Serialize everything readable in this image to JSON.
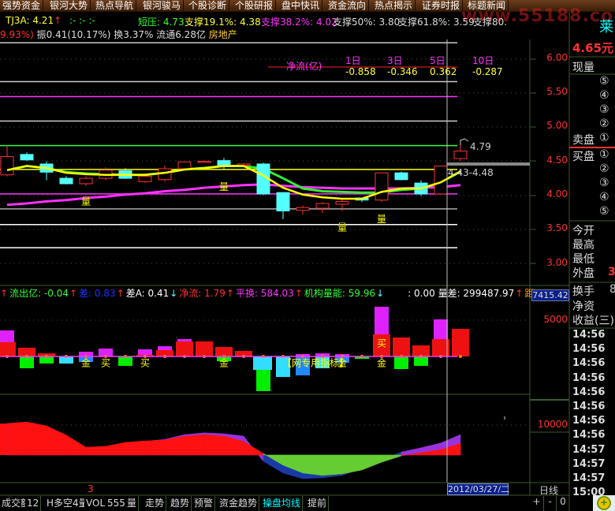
{
  "menu": [
    "强势资金",
    "银河大势",
    "热点导航",
    "银河骏马",
    "个股诊断",
    "个股研报",
    "盘中快讯",
    "资金流向",
    "热点揭示",
    "证券时报",
    "标题新闻"
  ],
  "watermark": "www.55188.com",
  "info_row": {
    "code": "TJ3A: 4.21",
    "code_arrow": "↑",
    "dashes": ":- :- :-",
    "short_pressure": "短压: 4.73",
    "support_19": "支撑19.1%: 4.38",
    "support_38": "支撑38.2%: 4.02",
    "support_50": "支撑50%: 3.80",
    "support_61": "支撑61.8%: 3.59",
    "support_80": "支撑80."
  },
  "stats_row": {
    "change": "9.93%)",
    "stats": "振0.41(10.17%) 换3.37% 流通6.28亿",
    "sector": "房地产"
  },
  "net_flow": {
    "label": "净流(亿)",
    "periods": [
      "1日",
      "3日",
      "5日",
      "10日"
    ],
    "values": [
      "-0.858",
      "-0.346",
      "0.362",
      "-0.287"
    ]
  },
  "price_labels": {
    "high_mark": "4.79",
    "range": "4.43-4.48"
  },
  "indicator_row": [
    {
      "text": "↑",
      "color": "#ff3232"
    },
    {
      "text": "流出亿: -0.04",
      "color": "#33ff33"
    },
    {
      "text": "↑",
      "color": "#ff3232"
    },
    {
      "text": "差: 0.83",
      "color": "#2030ff"
    },
    {
      "text": "↑",
      "color": "#ff3232"
    },
    {
      "text": "差A: 0.41",
      "color": "#ffffff"
    },
    {
      "text": "↓",
      "color": "#54ffff"
    },
    {
      "text": "净流: 1.79",
      "color": "#ff3232"
    },
    {
      "text": "↑",
      "color": "#ff3232"
    },
    {
      "text": "平换: 584.03",
      "color": "#ff33ff"
    },
    {
      "text": "↑",
      "color": "#ff3232"
    },
    {
      "text": "机构量能: 59.96",
      "color": "#33ff33"
    },
    {
      "text": "↓",
      "color": "#54ffff"
    },
    {
      "text": ": 0.00 量差: 299487.97",
      "color": "#ffffff"
    },
    {
      "text": "↑",
      "color": "#ff3232"
    },
    {
      "text": "距",
      "color": "#ff9900"
    }
  ],
  "axis_box_value": "7415.42",
  "right_panel": {
    "name_char": "莱",
    "price": "4.65元",
    "current_volume": "现量",
    "sell_label": "卖盘",
    "buy_label": "买盘",
    "sell_levels": [
      "⑤",
      "④",
      "③",
      "②",
      "①"
    ],
    "buy_levels": [
      "①",
      "②",
      "③",
      "④",
      "⑤"
    ],
    "open": "今开",
    "high": "最高",
    "low": "最低",
    "outer": "外盘",
    "outer_value": "3",
    "turnover": "换手",
    "turnover_value": "8",
    "net_assets": "净资",
    "eps": "收益(三)",
    "times": [
      "14:56",
      "14:56",
      "14:56",
      "14:56",
      "14:56",
      "14:56",
      "14:56",
      "14:56",
      "14:57",
      "14:57",
      "14:57",
      "15:00"
    ]
  },
  "status_row": {
    "marker": "3",
    "date": "2012/03/27/二",
    "period": "日线"
  },
  "tabs": [
    {
      "label": "成交额",
      "active": false
    },
    {
      "label": "12",
      "active": false
    },
    {
      "label": "H多空4量",
      "active": false
    },
    {
      "label": "VOL",
      "active": false
    },
    {
      "label": "555",
      "active": false
    },
    {
      "label": "量",
      "active": false
    },
    {
      "label": "走势",
      "active": false
    },
    {
      "label": "趋势",
      "active": false
    },
    {
      "label": "预警",
      "active": false
    },
    {
      "label": "资金趋势",
      "active": false
    },
    {
      "label": "操盘均线",
      "active": true
    },
    {
      "label": "提前",
      "active": false
    }
  ],
  "zoom_buttons": [
    "+",
    "-",
    "0"
  ],
  "colors": {
    "up": "#ff3232",
    "down": "#54ffff",
    "bg": "#000000",
    "grid": "#3a5a2a",
    "accent": "#00ffff"
  },
  "chart_data": [
    {
      "type": "candlestick",
      "y_ticks": [
        "6.00",
        "5.50",
        "5.00",
        "4.50",
        "4.00",
        "3.50",
        "3.00"
      ],
      "ylim": [
        3.0,
        6.0
      ],
      "candles": [
        [
          4.3,
          4.73,
          4.28,
          4.57
        ],
        [
          4.6,
          4.63,
          4.5,
          4.52
        ],
        [
          4.46,
          4.5,
          4.22,
          4.34
        ],
        [
          4.25,
          4.28,
          4.16,
          4.17
        ],
        [
          4.17,
          4.28,
          4.14,
          4.25
        ],
        [
          4.25,
          4.41,
          4.22,
          4.37
        ],
        [
          4.36,
          4.4,
          4.24,
          4.25
        ],
        [
          4.2,
          4.3,
          4.18,
          4.28
        ],
        [
          4.23,
          4.44,
          4.2,
          4.39
        ],
        [
          4.39,
          4.49,
          4.39,
          4.49
        ],
        [
          4.49,
          4.51,
          4.48,
          4.5
        ],
        [
          4.51,
          4.55,
          4.38,
          4.42
        ],
        [
          4.44,
          4.47,
          4.42,
          4.46
        ],
        [
          4.46,
          4.48,
          4.0,
          4.02
        ],
        [
          4.04,
          4.05,
          3.65,
          3.77
        ],
        [
          3.78,
          3.85,
          3.72,
          3.82
        ],
        [
          3.81,
          3.9,
          3.74,
          3.88
        ],
        [
          3.87,
          3.95,
          3.77,
          3.91
        ],
        [
          3.96,
          3.96,
          3.9,
          3.93
        ],
        [
          3.93,
          4.33,
          3.9,
          4.33
        ],
        [
          4.33,
          4.35,
          4.22,
          4.23
        ],
        [
          4.18,
          4.22,
          3.99,
          4.02
        ],
        [
          4.02,
          4.43,
          4.02,
          4.43
        ],
        [
          4.54,
          4.79,
          4.5,
          4.65
        ]
      ],
      "ma_yellow": [
        4.37,
        4.43,
        4.4,
        4.33,
        4.31,
        4.3,
        4.3,
        4.3,
        4.33,
        4.38,
        4.4,
        4.43,
        4.43,
        4.29,
        4.11,
        4.01,
        3.97,
        3.95,
        3.95,
        4.05,
        4.1,
        4.1,
        4.19,
        4.35
      ],
      "ma_green": [
        4.37,
        4.43,
        4.4,
        4.34,
        4.32,
        4.31,
        4.3,
        4.3,
        4.33,
        4.38,
        4.4,
        4.43,
        4.43,
        4.39,
        4.25,
        4.1,
        4.06,
        4.05,
        4.04,
        4.04,
        4.08,
        4.1,
        4.19,
        4.35
      ],
      "ma_magenta": [
        3.86,
        3.88,
        3.91,
        3.93,
        3.96,
        3.98,
        4.01,
        4.03,
        4.06,
        4.08,
        4.11,
        4.13,
        4.15,
        4.16,
        4.14,
        4.12,
        4.11,
        4.1,
        4.1,
        4.1,
        4.1,
        4.11,
        4.12,
        4.15
      ],
      "ref_lines": [
        {
          "price": 6.24,
          "color": "#cccccc"
        },
        {
          "price": 5.67,
          "color": "#cccccc"
        },
        {
          "price": 5.45,
          "color": "#ff33ff"
        },
        {
          "price": 5.09,
          "color": "#cccccc"
        },
        {
          "price": 4.73,
          "color": "#33ff33"
        },
        {
          "price": 4.38,
          "color": "#ffff00"
        },
        {
          "price": 4.02,
          "color": "#ff33ff"
        },
        {
          "price": 3.8,
          "color": "#aaaaaa"
        },
        {
          "price": 3.57,
          "color": "#ffffff"
        },
        {
          "price": 3.23,
          "color": "#ffffff"
        }
      ],
      "annotations": [
        {
          "text": "量",
          "index": 4,
          "price": 3.86
        },
        {
          "text": "量",
          "index": 11,
          "price": 4.08
        },
        {
          "text": "量",
          "index": 17,
          "price": 3.48
        },
        {
          "text": "量",
          "index": 19,
          "price": 3.6
        }
      ]
    },
    {
      "type": "bar",
      "y_ticks": [
        "5000"
      ],
      "bars": [
        {
          "up": 1960,
          "ext": 3590,
          "down": 0,
          "dc": "g"
        },
        {
          "up": 1200,
          "ext": 0,
          "down": -1630,
          "dc": "g"
        },
        {
          "up": 430,
          "ext": 0,
          "down": -980,
          "dc": "g"
        },
        {
          "up": 0,
          "ext": 0,
          "down": -980,
          "dc": "c"
        },
        {
          "up": 0,
          "ext": 650,
          "down": -760,
          "dc": "b"
        },
        {
          "up": 0,
          "ext": 1090,
          "down": 0,
          "dc": "g"
        },
        {
          "up": 0,
          "ext": 0,
          "down": -1300,
          "dc": "g"
        },
        {
          "up": 220,
          "ext": 980,
          "down": 0,
          "dc": "g"
        },
        {
          "up": 870,
          "ext": 1410,
          "down": 0,
          "dc": "g"
        },
        {
          "up": 2070,
          "ext": 2390,
          "down": 0,
          "dc": "g"
        },
        {
          "up": 2070,
          "ext": 0,
          "down": 0,
          "dc": "g"
        },
        {
          "up": 1300,
          "ext": 0,
          "down": -650,
          "dc": "g"
        },
        {
          "up": 760,
          "ext": 0,
          "down": 0,
          "dc": "g"
        },
        {
          "up": 0,
          "ext": 0,
          "down": -4780,
          "dc": "g",
          "down2": -1850
        },
        {
          "up": 0,
          "ext": 0,
          "down": -2830,
          "dc": "c"
        },
        {
          "up": 0,
          "ext": 330,
          "down": -2610,
          "dc": "b"
        },
        {
          "up": 0,
          "ext": 430,
          "down": -1630,
          "dc": "c"
        },
        {
          "up": 0,
          "ext": 330,
          "down": -870,
          "dc": "b"
        },
        {
          "up": 0,
          "ext": 0,
          "down": -330,
          "dc": "g"
        },
        {
          "up": 3040,
          "ext": 6850,
          "down": 0,
          "dc": "g"
        },
        {
          "up": 2610,
          "ext": 0,
          "down": -1740,
          "dc": "g"
        },
        {
          "up": 1520,
          "ext": 0,
          "down": -1300,
          "dc": "g"
        },
        {
          "up": 2390,
          "ext": 5110,
          "down": 0,
          "dc": "g"
        },
        {
          "up": 3800,
          "ext": 0,
          "down": 0,
          "dc": "g"
        }
      ],
      "annotations": [
        {
          "text": "金",
          "index": 4,
          "value": -800
        },
        {
          "text": "买",
          "index": 5,
          "value": -800
        },
        {
          "text": "买",
          "index": 7,
          "value": -800
        },
        {
          "text": "金",
          "index": 11,
          "value": -800
        },
        {
          "text": "【网专用指标】",
          "index": 14.2,
          "value": -800
        },
        {
          "text": "金",
          "index": 17,
          "value": -800
        },
        {
          "text": "买",
          "index": 19,
          "value": 1900
        },
        {
          "text": "金",
          "index": 19,
          "value": -800
        }
      ]
    },
    {
      "type": "area",
      "y_ticks": [
        "10000"
      ],
      "line1": [
        10500,
        11000,
        9700,
        6600,
        2600,
        2900,
        4200,
        4700,
        5000,
        6300,
        6800,
        6300,
        4500,
        500,
        -3400,
        -6000,
        -6800,
        -6300,
        -5000,
        -2400,
        -300,
        800,
        1800,
        3900
      ],
      "line2": [
        10500,
        11000,
        9700,
        6600,
        2300,
        2600,
        3900,
        4600,
        5200,
        6800,
        7400,
        7100,
        6300,
        -2100,
        -6000,
        -7900,
        -7600,
        -6800,
        -4500,
        -1500,
        1000,
        2400,
        4000,
        6800
      ]
    }
  ]
}
